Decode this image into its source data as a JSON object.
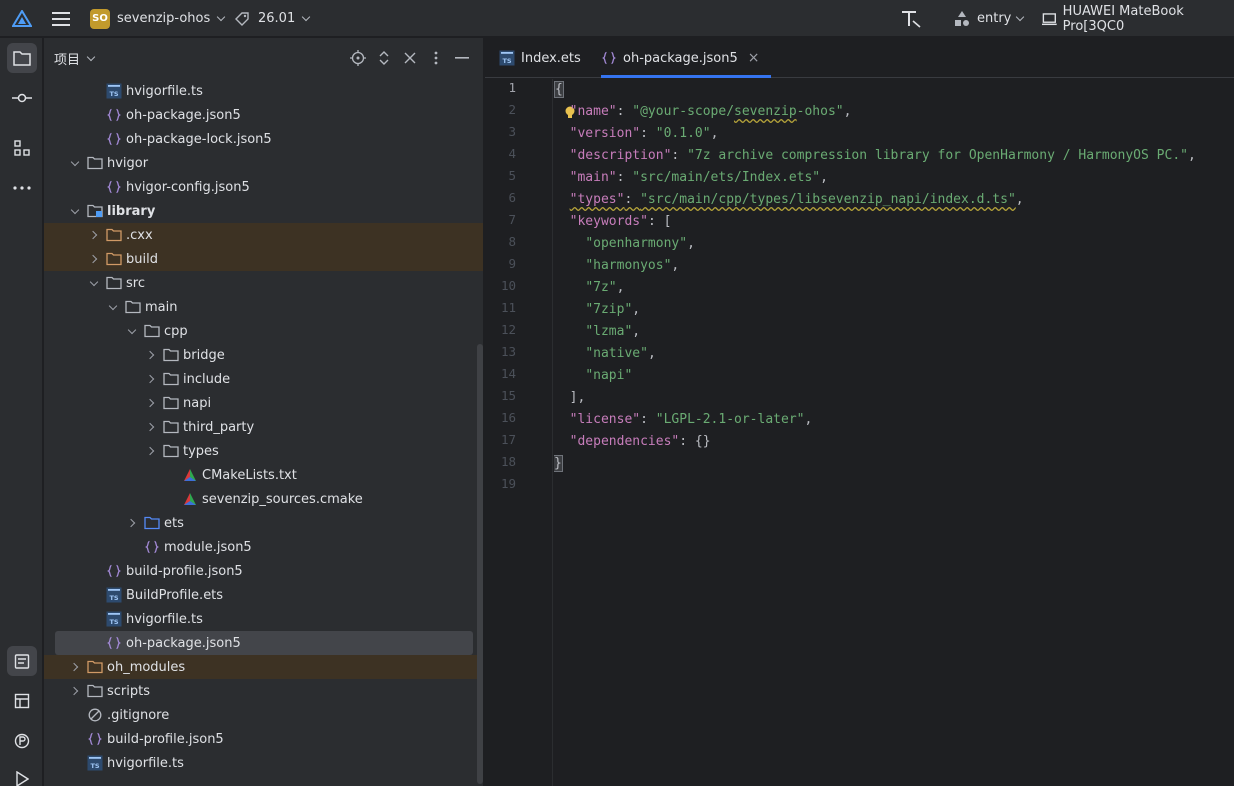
{
  "titlebar": {
    "project_badge": "SO",
    "project_name": "sevenzip-ohos",
    "version": "26.01",
    "run_config": "entry",
    "device": "HUAWEI MateBook Pro[3QC0"
  },
  "panel": {
    "title": "项目"
  },
  "tree": [
    {
      "label": "hvigorfile.ts",
      "indent": 3,
      "icon": "ts-file-icon"
    },
    {
      "label": "oh-package.json5",
      "indent": 3,
      "icon": "json-icon"
    },
    {
      "label": "oh-package-lock.json5",
      "indent": 3,
      "icon": "json-icon"
    },
    {
      "label": "hvigor",
      "indent": 2,
      "icon": "folder-icon",
      "arrow": "down"
    },
    {
      "label": "hvigor-config.json5",
      "indent": 3,
      "icon": "json-icon"
    },
    {
      "label": "library",
      "indent": 2,
      "icon": "module-folder-icon",
      "arrow": "down",
      "bold": true
    },
    {
      "label": ".cxx",
      "indent": 3,
      "icon": "excluded-folder-icon",
      "arrow": "right",
      "highlight": true
    },
    {
      "label": "build",
      "indent": 3,
      "icon": "excluded-folder-icon",
      "arrow": "right",
      "highlight": true
    },
    {
      "label": "src",
      "indent": 3,
      "icon": "folder-icon",
      "arrow": "down"
    },
    {
      "label": "main",
      "indent": 4,
      "icon": "folder-icon",
      "arrow": "down"
    },
    {
      "label": "cpp",
      "indent": 5,
      "icon": "folder-icon",
      "arrow": "down"
    },
    {
      "label": "bridge",
      "indent": 6,
      "icon": "folder-icon",
      "arrow": "right"
    },
    {
      "label": "include",
      "indent": 6,
      "icon": "folder-icon",
      "arrow": "right"
    },
    {
      "label": "napi",
      "indent": 6,
      "icon": "folder-icon",
      "arrow": "right"
    },
    {
      "label": "third_party",
      "indent": 6,
      "icon": "folder-icon",
      "arrow": "right"
    },
    {
      "label": "types",
      "indent": 6,
      "icon": "folder-icon",
      "arrow": "right"
    },
    {
      "label": "CMakeLists.txt",
      "indent": 7,
      "icon": "cmake-icon"
    },
    {
      "label": "sevenzip_sources.cmake",
      "indent": 7,
      "icon": "cmake-icon"
    },
    {
      "label": "ets",
      "indent": 5,
      "icon": "source-folder-icon",
      "arrow": "right"
    },
    {
      "label": "module.json5",
      "indent": 5,
      "icon": "json-icon"
    },
    {
      "label": "build-profile.json5",
      "indent": 3,
      "icon": "json-icon"
    },
    {
      "label": "BuildProfile.ets",
      "indent": 3,
      "icon": "ts-file-icon"
    },
    {
      "label": "hvigorfile.ts",
      "indent": 3,
      "icon": "ts-file-icon"
    },
    {
      "label": "oh-package.json5",
      "indent": 3,
      "icon": "json-icon",
      "selected": true
    },
    {
      "label": "oh_modules",
      "indent": 2,
      "icon": "excluded-folder-icon",
      "arrow": "right",
      "highlight": true
    },
    {
      "label": "scripts",
      "indent": 2,
      "icon": "folder-icon",
      "arrow": "right"
    },
    {
      "label": ".gitignore",
      "indent": 2,
      "icon": "ignore-file-icon"
    },
    {
      "label": "build-profile.json5",
      "indent": 2,
      "icon": "json-icon"
    },
    {
      "label": "hvigorfile.ts",
      "indent": 2,
      "icon": "ts-file-icon"
    }
  ],
  "tabs": [
    {
      "label": "Index.ets",
      "icon": "ts-file-icon",
      "active": false
    },
    {
      "label": "oh-package.json5",
      "icon": "json-icon",
      "active": true,
      "close": "×"
    }
  ],
  "editor": {
    "line_numbers": [
      "1",
      "2",
      "3",
      "4",
      "5",
      "6",
      "7",
      "8",
      "9",
      "10",
      "11",
      "12",
      "13",
      "14",
      "15",
      "16",
      "17",
      "18",
      "19"
    ],
    "lines": [
      [
        {
          "t": "{",
          "c": "p brace-hl"
        }
      ],
      [
        {
          "t": "  "
        },
        {
          "t": "\"name\"",
          "c": "k"
        },
        {
          "t": ": ",
          "c": "p"
        },
        {
          "t": "\"@your-scope/",
          "c": "s"
        },
        {
          "t": "sevenzip",
          "c": "s squig"
        },
        {
          "t": "-ohos\"",
          "c": "s"
        },
        {
          "t": ",",
          "c": "p"
        }
      ],
      [
        {
          "t": "  "
        },
        {
          "t": "\"version\"",
          "c": "k"
        },
        {
          "t": ": ",
          "c": "p"
        },
        {
          "t": "\"0.1.0\"",
          "c": "s"
        },
        {
          "t": ",",
          "c": "p"
        }
      ],
      [
        {
          "t": "  "
        },
        {
          "t": "\"description\"",
          "c": "k"
        },
        {
          "t": ": ",
          "c": "p"
        },
        {
          "t": "\"7z archive compression library for OpenHarmony / HarmonyOS PC.\"",
          "c": "s"
        },
        {
          "t": ",",
          "c": "p"
        }
      ],
      [
        {
          "t": "  "
        },
        {
          "t": "\"main\"",
          "c": "k"
        },
        {
          "t": ": ",
          "c": "p"
        },
        {
          "t": "\"src/main/ets/Index.ets\"",
          "c": "s"
        },
        {
          "t": ",",
          "c": "p"
        }
      ],
      [
        {
          "t": "  "
        },
        {
          "t": "\"types\"",
          "c": "k squig"
        },
        {
          "t": ": ",
          "c": "p squig"
        },
        {
          "t": "\"src/main/cpp/types/libsevenzip_napi/index.d.ts\"",
          "c": "s squig"
        },
        {
          "t": ",",
          "c": "p"
        }
      ],
      [
        {
          "t": "  "
        },
        {
          "t": "\"keywords\"",
          "c": "k"
        },
        {
          "t": ": [",
          "c": "p"
        }
      ],
      [
        {
          "t": "    "
        },
        {
          "t": "\"openharmony\"",
          "c": "s"
        },
        {
          "t": ",",
          "c": "p"
        }
      ],
      [
        {
          "t": "    "
        },
        {
          "t": "\"harmonyos\"",
          "c": "s"
        },
        {
          "t": ",",
          "c": "p"
        }
      ],
      [
        {
          "t": "    "
        },
        {
          "t": "\"7z\"",
          "c": "s"
        },
        {
          "t": ",",
          "c": "p"
        }
      ],
      [
        {
          "t": "    "
        },
        {
          "t": "\"7zip\"",
          "c": "s"
        },
        {
          "t": ",",
          "c": "p"
        }
      ],
      [
        {
          "t": "    "
        },
        {
          "t": "\"lzma\"",
          "c": "s"
        },
        {
          "t": ",",
          "c": "p"
        }
      ],
      [
        {
          "t": "    "
        },
        {
          "t": "\"native\"",
          "c": "s"
        },
        {
          "t": ",",
          "c": "p"
        }
      ],
      [
        {
          "t": "    "
        },
        {
          "t": "\"napi\"",
          "c": "s"
        }
      ],
      [
        {
          "t": "  "
        },
        {
          "t": "],",
          "c": "p"
        }
      ],
      [
        {
          "t": "  "
        },
        {
          "t": "\"license\"",
          "c": "k"
        },
        {
          "t": ": ",
          "c": "p"
        },
        {
          "t": "\"LGPL-2.1-or-later\"",
          "c": "s"
        },
        {
          "t": ",",
          "c": "p"
        }
      ],
      [
        {
          "t": "  "
        },
        {
          "t": "\"dependencies\"",
          "c": "k"
        },
        {
          "t": ": {}",
          "c": "p"
        }
      ],
      [
        {
          "t": "}",
          "c": "p brace-hl"
        }
      ],
      []
    ]
  },
  "colors": {
    "accent": "#3574f0",
    "key": "#c77dbb",
    "string": "#6aab73",
    "excluded_row": "#3d3223",
    "folder": "#b4b8bf",
    "excluded_folder": "#d19a66"
  }
}
